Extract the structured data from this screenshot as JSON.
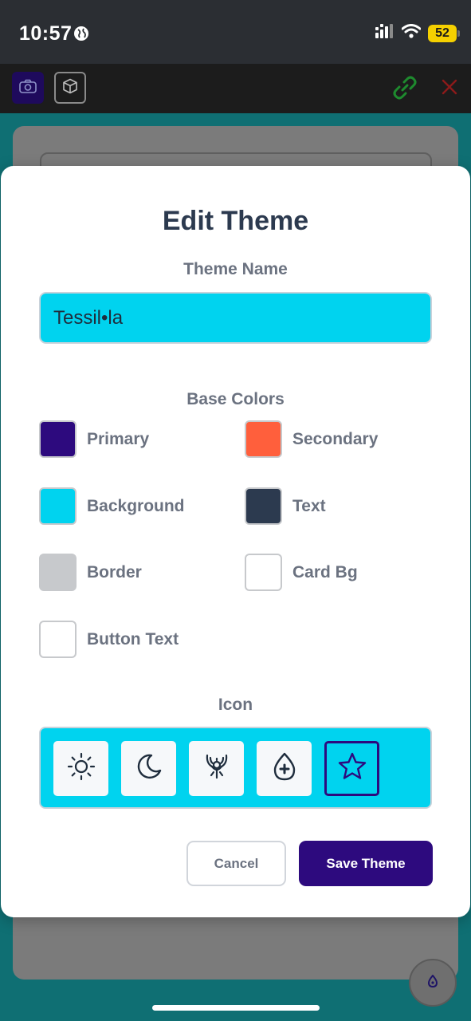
{
  "status_bar": {
    "time": "10:57",
    "battery": "52"
  },
  "colors": {
    "accent": "#2d0a7e",
    "cyan": "#00d3ef"
  },
  "toolbar": {
    "icons": [
      "camera-icon",
      "cube-icon",
      "link-icon",
      "close-icon"
    ]
  },
  "modal": {
    "title": "Edit Theme",
    "theme_name_label": "Theme Name",
    "theme_name_value": "Tessil•la",
    "base_colors_label": "Base Colors",
    "base_colors": [
      {
        "label": "Primary",
        "color": "#2d0a7e"
      },
      {
        "label": "Secondary",
        "color": "#ff5f3c"
      },
      {
        "label": "Background",
        "color": "#00d3ef"
      },
      {
        "label": "Text",
        "color": "#2c3a4f"
      },
      {
        "label": "Border",
        "color": "#c7c9cc"
      },
      {
        "label": "Card Bg",
        "color": "#ffffff"
      },
      {
        "label": "Button Text",
        "color": "#ffffff"
      }
    ],
    "icon_label": "Icon",
    "icon_options": [
      {
        "name": "sun-icon",
        "selected": false
      },
      {
        "name": "moon-icon",
        "selected": false
      },
      {
        "name": "ornament-icon",
        "selected": false
      },
      {
        "name": "drop-icon",
        "selected": false
      },
      {
        "name": "star-icon",
        "selected": true
      }
    ],
    "cancel_label": "Cancel",
    "save_label": "Save Theme"
  }
}
